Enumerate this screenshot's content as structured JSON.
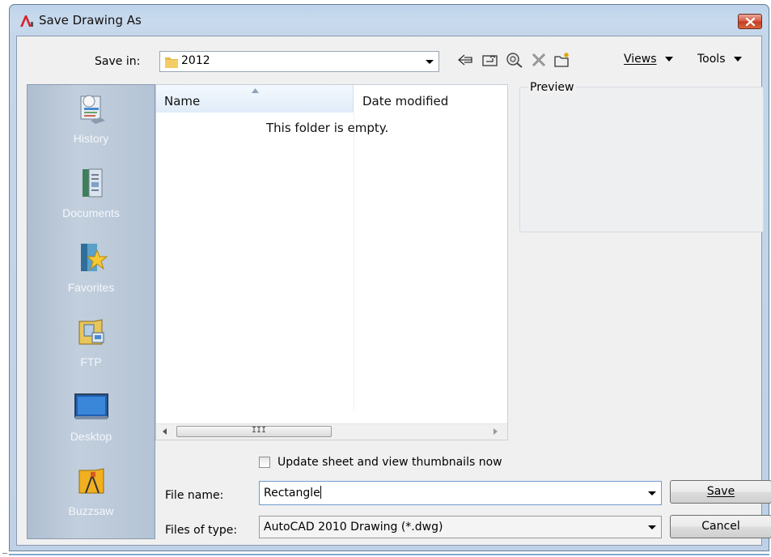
{
  "window": {
    "title": "Save Drawing As",
    "close_icon": "close-icon"
  },
  "toolbar": {
    "save_in_label": "Save in:",
    "save_in_value": "2012",
    "icons": [
      "back-icon",
      "up-folder-icon",
      "search-web-icon",
      "delete-icon",
      "new-folder-icon"
    ],
    "views_label": "Views",
    "tools_label": "Tools"
  },
  "places": [
    {
      "label": "History",
      "icon": "history-icon"
    },
    {
      "label": "Documents",
      "icon": "documents-icon"
    },
    {
      "label": "Favorites",
      "icon": "favorites-icon"
    },
    {
      "label": "FTP",
      "icon": "ftp-icon"
    },
    {
      "label": "Desktop",
      "icon": "desktop-icon"
    },
    {
      "label": "Buzzsaw",
      "icon": "buzzsaw-icon"
    }
  ],
  "file_list": {
    "columns": [
      "Name",
      "Date modified"
    ],
    "empty_message": "This folder is empty.",
    "scroll_grip": "III"
  },
  "preview": {
    "label": "Preview"
  },
  "options": {
    "update_thumbnails_label": "Update sheet and view thumbnails now",
    "update_thumbnails_checked": false
  },
  "form": {
    "file_name_label": "File name:",
    "file_name_value": "Rectangle",
    "files_of_type_label": "Files of type:",
    "files_of_type_value": "AutoCAD 2010 Drawing (*.dwg)"
  },
  "buttons": {
    "save": "Save",
    "cancel": "Cancel"
  },
  "colors": {
    "title_gradient": "#c4d6ea",
    "places_bg": "#b8c6d7",
    "dialog_bg": "#f0f0f0",
    "close_red": "#c9402a"
  }
}
